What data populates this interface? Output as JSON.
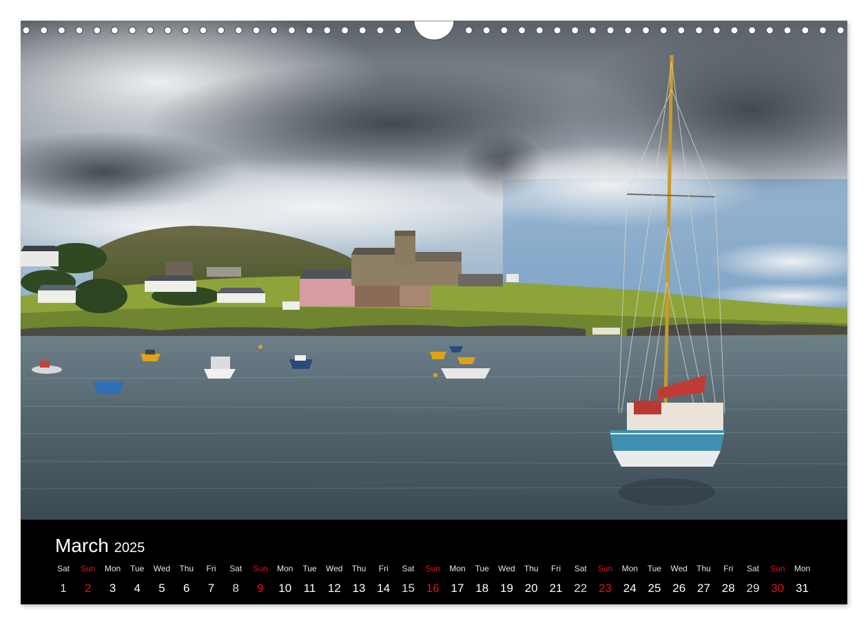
{
  "calendar": {
    "month": "March",
    "year": "2025",
    "days": [
      {
        "name": "Sat",
        "num": "1",
        "kind": "sat"
      },
      {
        "name": "Sun",
        "num": "2",
        "kind": "sun"
      },
      {
        "name": "Mon",
        "num": "3",
        "kind": "wd"
      },
      {
        "name": "Tue",
        "num": "4",
        "kind": "wd"
      },
      {
        "name": "Wed",
        "num": "5",
        "kind": "wd"
      },
      {
        "name": "Thu",
        "num": "6",
        "kind": "wd"
      },
      {
        "name": "Fri",
        "num": "7",
        "kind": "wd"
      },
      {
        "name": "Sat",
        "num": "8",
        "kind": "sat"
      },
      {
        "name": "Sun",
        "num": "9",
        "kind": "sun"
      },
      {
        "name": "Mon",
        "num": "10",
        "kind": "wd"
      },
      {
        "name": "Tue",
        "num": "11",
        "kind": "wd"
      },
      {
        "name": "Wed",
        "num": "12",
        "kind": "wd"
      },
      {
        "name": "Thu",
        "num": "13",
        "kind": "wd"
      },
      {
        "name": "Fri",
        "num": "14",
        "kind": "wd"
      },
      {
        "name": "Sat",
        "num": "15",
        "kind": "sat"
      },
      {
        "name": "Sun",
        "num": "16",
        "kind": "sun"
      },
      {
        "name": "Mon",
        "num": "17",
        "kind": "wd"
      },
      {
        "name": "Tue",
        "num": "18",
        "kind": "wd"
      },
      {
        "name": "Wed",
        "num": "19",
        "kind": "wd"
      },
      {
        "name": "Thu",
        "num": "20",
        "kind": "wd"
      },
      {
        "name": "Fri",
        "num": "21",
        "kind": "wd"
      },
      {
        "name": "Sat",
        "num": "22",
        "kind": "sat"
      },
      {
        "name": "Sun",
        "num": "23",
        "kind": "sun"
      },
      {
        "name": "Mon",
        "num": "24",
        "kind": "wd"
      },
      {
        "name": "Tue",
        "num": "25",
        "kind": "wd"
      },
      {
        "name": "Wed",
        "num": "26",
        "kind": "wd"
      },
      {
        "name": "Thu",
        "num": "27",
        "kind": "wd"
      },
      {
        "name": "Fri",
        "num": "28",
        "kind": "wd"
      },
      {
        "name": "Sat",
        "num": "29",
        "kind": "sat"
      },
      {
        "name": "Sun",
        "num": "30",
        "kind": "sun"
      },
      {
        "name": "Mon",
        "num": "31",
        "kind": "wd"
      }
    ]
  },
  "colors": {
    "sunday": "#e0141e",
    "calendar_bg": "#000000",
    "sea": "#5d6f78",
    "grass": "#8ea43a",
    "hull": "#3e8fb0"
  },
  "photo": {
    "scene": "harbour-with-sailboat"
  }
}
